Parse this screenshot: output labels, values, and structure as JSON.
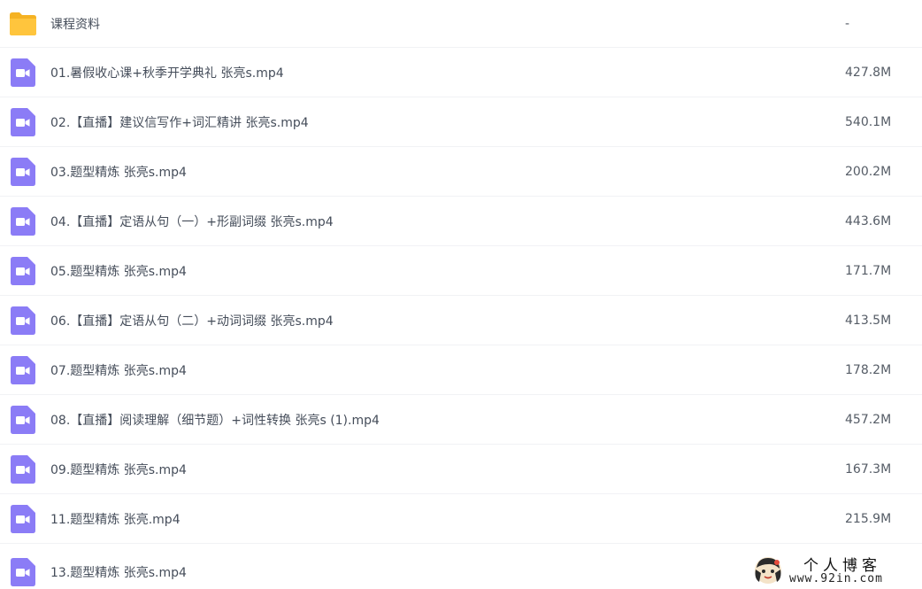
{
  "files": [
    {
      "name": "课程资料",
      "size": "-",
      "type": "folder",
      "icon": "folder-icon"
    },
    {
      "name": "01.暑假收心课+秋季开学典礼 张亮s.mp4",
      "size": "427.8M",
      "type": "video",
      "icon": "video-file-icon"
    },
    {
      "name": "02.【直播】建议信写作+词汇精讲 张亮s.mp4",
      "size": "540.1M",
      "type": "video",
      "icon": "video-file-icon"
    },
    {
      "name": "03.题型精炼 张亮s.mp4",
      "size": "200.2M",
      "type": "video",
      "icon": "video-file-icon"
    },
    {
      "name": "04.【直播】定语从句（一）+形副词缀 张亮s.mp4",
      "size": "443.6M",
      "type": "video",
      "icon": "video-file-icon"
    },
    {
      "name": "05.题型精炼 张亮s.mp4",
      "size": "171.7M",
      "type": "video",
      "icon": "video-file-icon"
    },
    {
      "name": "06.【直播】定语从句（二）+动词词缀 张亮s.mp4",
      "size": "413.5M",
      "type": "video",
      "icon": "video-file-icon"
    },
    {
      "name": "07.题型精炼 张亮s.mp4",
      "size": "178.2M",
      "type": "video",
      "icon": "video-file-icon"
    },
    {
      "name": "08.【直播】阅读理解（细节题）+词性转换 张亮s (1).mp4",
      "size": "457.2M",
      "type": "video",
      "icon": "video-file-icon"
    },
    {
      "name": "09.题型精炼 张亮s.mp4",
      "size": "167.3M",
      "type": "video",
      "icon": "video-file-icon"
    },
    {
      "name": "11.题型精炼 张亮.mp4",
      "size": "215.9M",
      "type": "video",
      "icon": "video-file-icon"
    },
    {
      "name": "13.题型精炼 张亮s.mp4",
      "size": "",
      "type": "video",
      "icon": "video-file-icon"
    }
  ],
  "watermark": {
    "title": "个人博客",
    "url": "www.92in.com",
    "icon": "avatar-logo-icon"
  },
  "colors": {
    "folder": "#ffc53d",
    "folder_dark": "#f5b223",
    "video": "#8b7cf6",
    "divider": "#f1f2f5"
  }
}
